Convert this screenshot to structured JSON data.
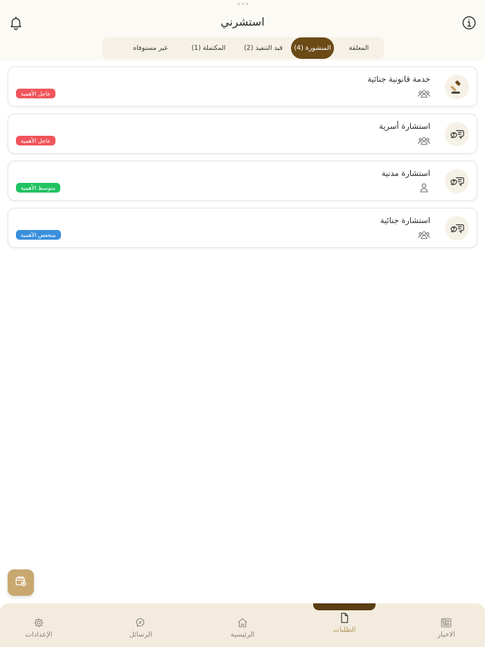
{
  "header": {
    "title": "استشرني",
    "notification_icon": "bell-icon",
    "info_icon": "info-icon"
  },
  "tabs": [
    {
      "label": "المعلقة",
      "active": false
    },
    {
      "label": "المنشورة (4)",
      "active": true
    },
    {
      "label": "قيد التنفيذ (2)",
      "active": false
    },
    {
      "label": "المكتملة (1)",
      "active": false
    },
    {
      "label": "غير مستوفاه",
      "active": false
    }
  ],
  "requests": [
    {
      "title": "خدمة قانونية جنائية",
      "icon": "gavel-icon",
      "audience_icon": "group-icon",
      "priority": "عاجل الأهمية",
      "priority_color": "#f0555b"
    },
    {
      "title": "استشارة أسرية",
      "icon": "chat-question-icon",
      "audience_icon": "group-icon",
      "priority": "عاجل الأهمية",
      "priority_color": "#f0555b"
    },
    {
      "title": "استشارة مدنية",
      "icon": "chat-question-icon",
      "audience_icon": "person-icon",
      "priority": "متوسط الأهمية",
      "priority_color": "#21c262"
    },
    {
      "title": "استشارة جنائية",
      "icon": "chat-question-icon",
      "audience_icon": "group-icon",
      "priority": "منخفض الأهمية",
      "priority_color": "#3a8fdc"
    }
  ],
  "fab_icon": "wallet-icon",
  "bottom_nav": [
    {
      "label": "الاخبار",
      "icon": "news-icon",
      "active": false
    },
    {
      "label": "الطلبات",
      "icon": "document-icon",
      "active": true
    },
    {
      "label": "الرئيسية",
      "icon": "home-icon",
      "active": false
    },
    {
      "label": "الرسائل",
      "icon": "messages-icon",
      "active": false
    },
    {
      "label": "الإعدادات",
      "icon": "gear-icon",
      "active": false
    }
  ],
  "colors": {
    "brand": "#6b4a16",
    "accent": "#c9a870",
    "tab_bg": "#f6f1e6",
    "nav_bg": "#f3ecde"
  }
}
